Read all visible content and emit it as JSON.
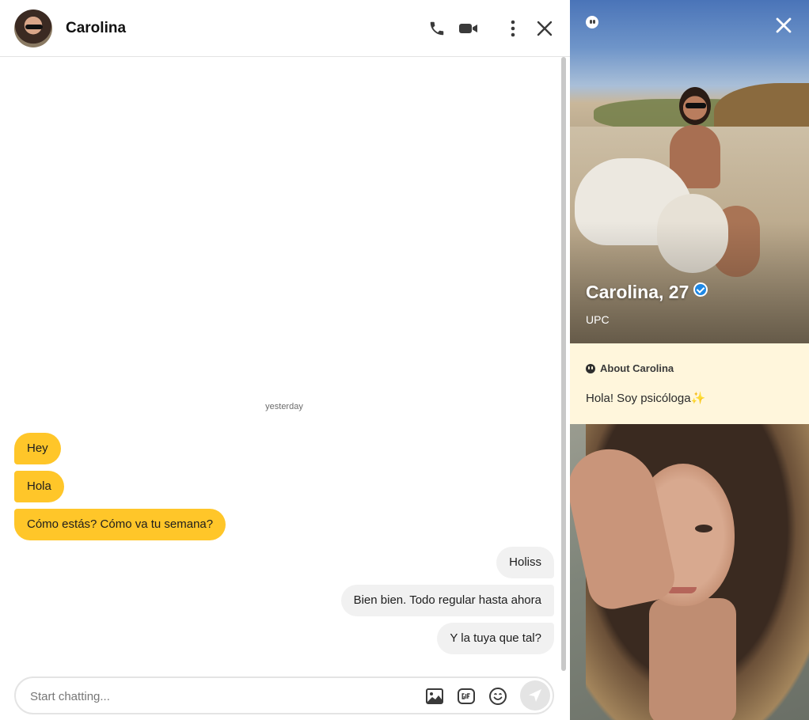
{
  "header": {
    "contact_name": "Carolina"
  },
  "chat": {
    "date_separator": "yesterday",
    "messages": [
      {
        "text": "Hey"
      },
      {
        "text": "Hola"
      },
      {
        "text": "Cómo estás? Cómo va tu semana?"
      },
      {
        "text": "Holiss"
      },
      {
        "text": "Bien bien. Todo regular hasta ahora"
      },
      {
        "text": "Y la tuya que tal?"
      }
    ],
    "composer_placeholder": "Start chatting...",
    "composer_value": ""
  },
  "profile": {
    "name_age": "Carolina, 27",
    "school": "UPC",
    "about_title": "About Carolina",
    "about_text": "Hola! Soy psicóloga✨"
  },
  "colors": {
    "incoming_bubble": "#ffc629",
    "outgoing_bubble": "#f1f1f1",
    "about_background": "#fff6dc",
    "verified_badge": "#1e88e5"
  },
  "icons": [
    "phone-icon",
    "video-camera-icon",
    "more-vertical-icon",
    "close-icon",
    "image-icon",
    "gif-icon",
    "emoji-icon",
    "send-icon",
    "verified-badge-icon",
    "profile-badge-icon"
  ]
}
